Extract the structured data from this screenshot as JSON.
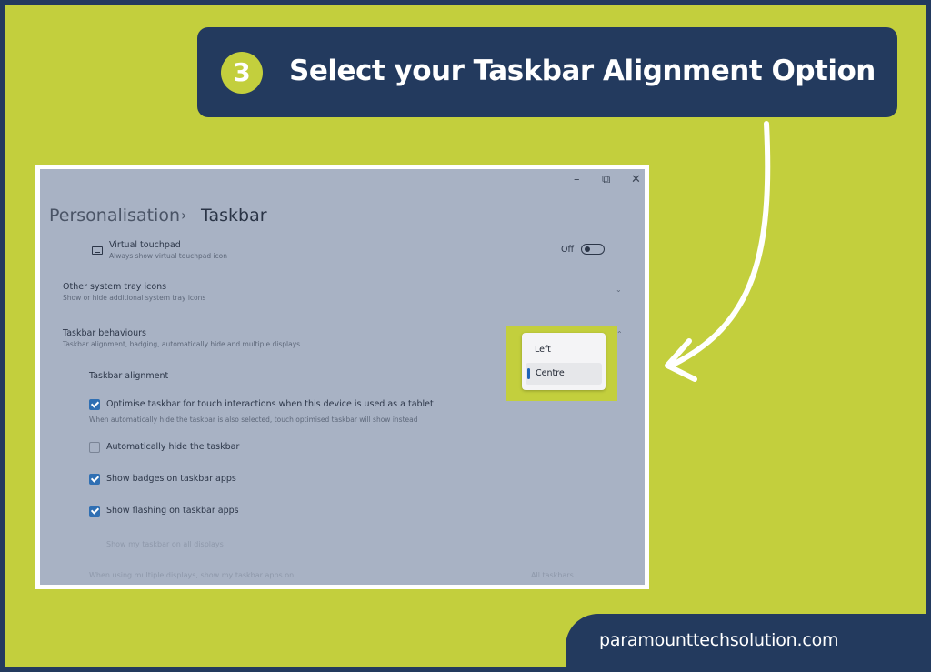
{
  "banner": {
    "step_number": "3",
    "title": "Select your Taskbar Alignment Option"
  },
  "window": {
    "minimize_glyph": "–",
    "restore_glyph": "⧉",
    "close_glyph": "✕",
    "breadcrumb_parent": "Personalisation",
    "breadcrumb_separator": "›",
    "breadcrumb_current": "Taskbar"
  },
  "settings": {
    "virtual_touchpad": {
      "title": "Virtual touchpad",
      "subtitle": "Always show virtual touchpad icon",
      "toggle_label": "Off",
      "toggle_on": false,
      "icon": "touchpad-icon"
    },
    "other_tray_icons": {
      "title": "Other system tray icons",
      "subtitle": "Show or hide additional system tray icons",
      "chevron": "⌄"
    },
    "taskbar_behaviours": {
      "title": "Taskbar behaviours",
      "subtitle": "Taskbar alignment, badging, automatically hide and multiple displays",
      "chevron": "⌃"
    },
    "taskbar_alignment_label": "Taskbar alignment",
    "checkboxes": [
      {
        "label": "Optimise taskbar for touch interactions when this device is used as a tablet",
        "checked": true
      },
      {
        "label": "Automatically hide the taskbar",
        "checked": false
      },
      {
        "label": "Show badges on taskbar apps",
        "checked": true
      },
      {
        "label": "Show flashing on taskbar apps",
        "checked": true
      }
    ],
    "touch_note": "When automatically hide the taskbar is also selected, touch optimised taskbar will show instead",
    "faint_row_1": "Show my taskbar on all displays",
    "faint_row_2": "When using multiple displays, show my taskbar apps on",
    "faint_row_2_value": "All taskbars"
  },
  "dropdown": {
    "options": [
      {
        "label": "Left",
        "selected": false
      },
      {
        "label": "Centre",
        "selected": true
      }
    ],
    "highlight_color": "#c3cf3d",
    "selected_indicator_color": "#1f64b8"
  },
  "footer": {
    "site": "paramounttechsolution.com"
  },
  "colors": {
    "background": "#c3cf3d",
    "navy": "#233a5e",
    "accent_blue": "#2f6fb3"
  }
}
